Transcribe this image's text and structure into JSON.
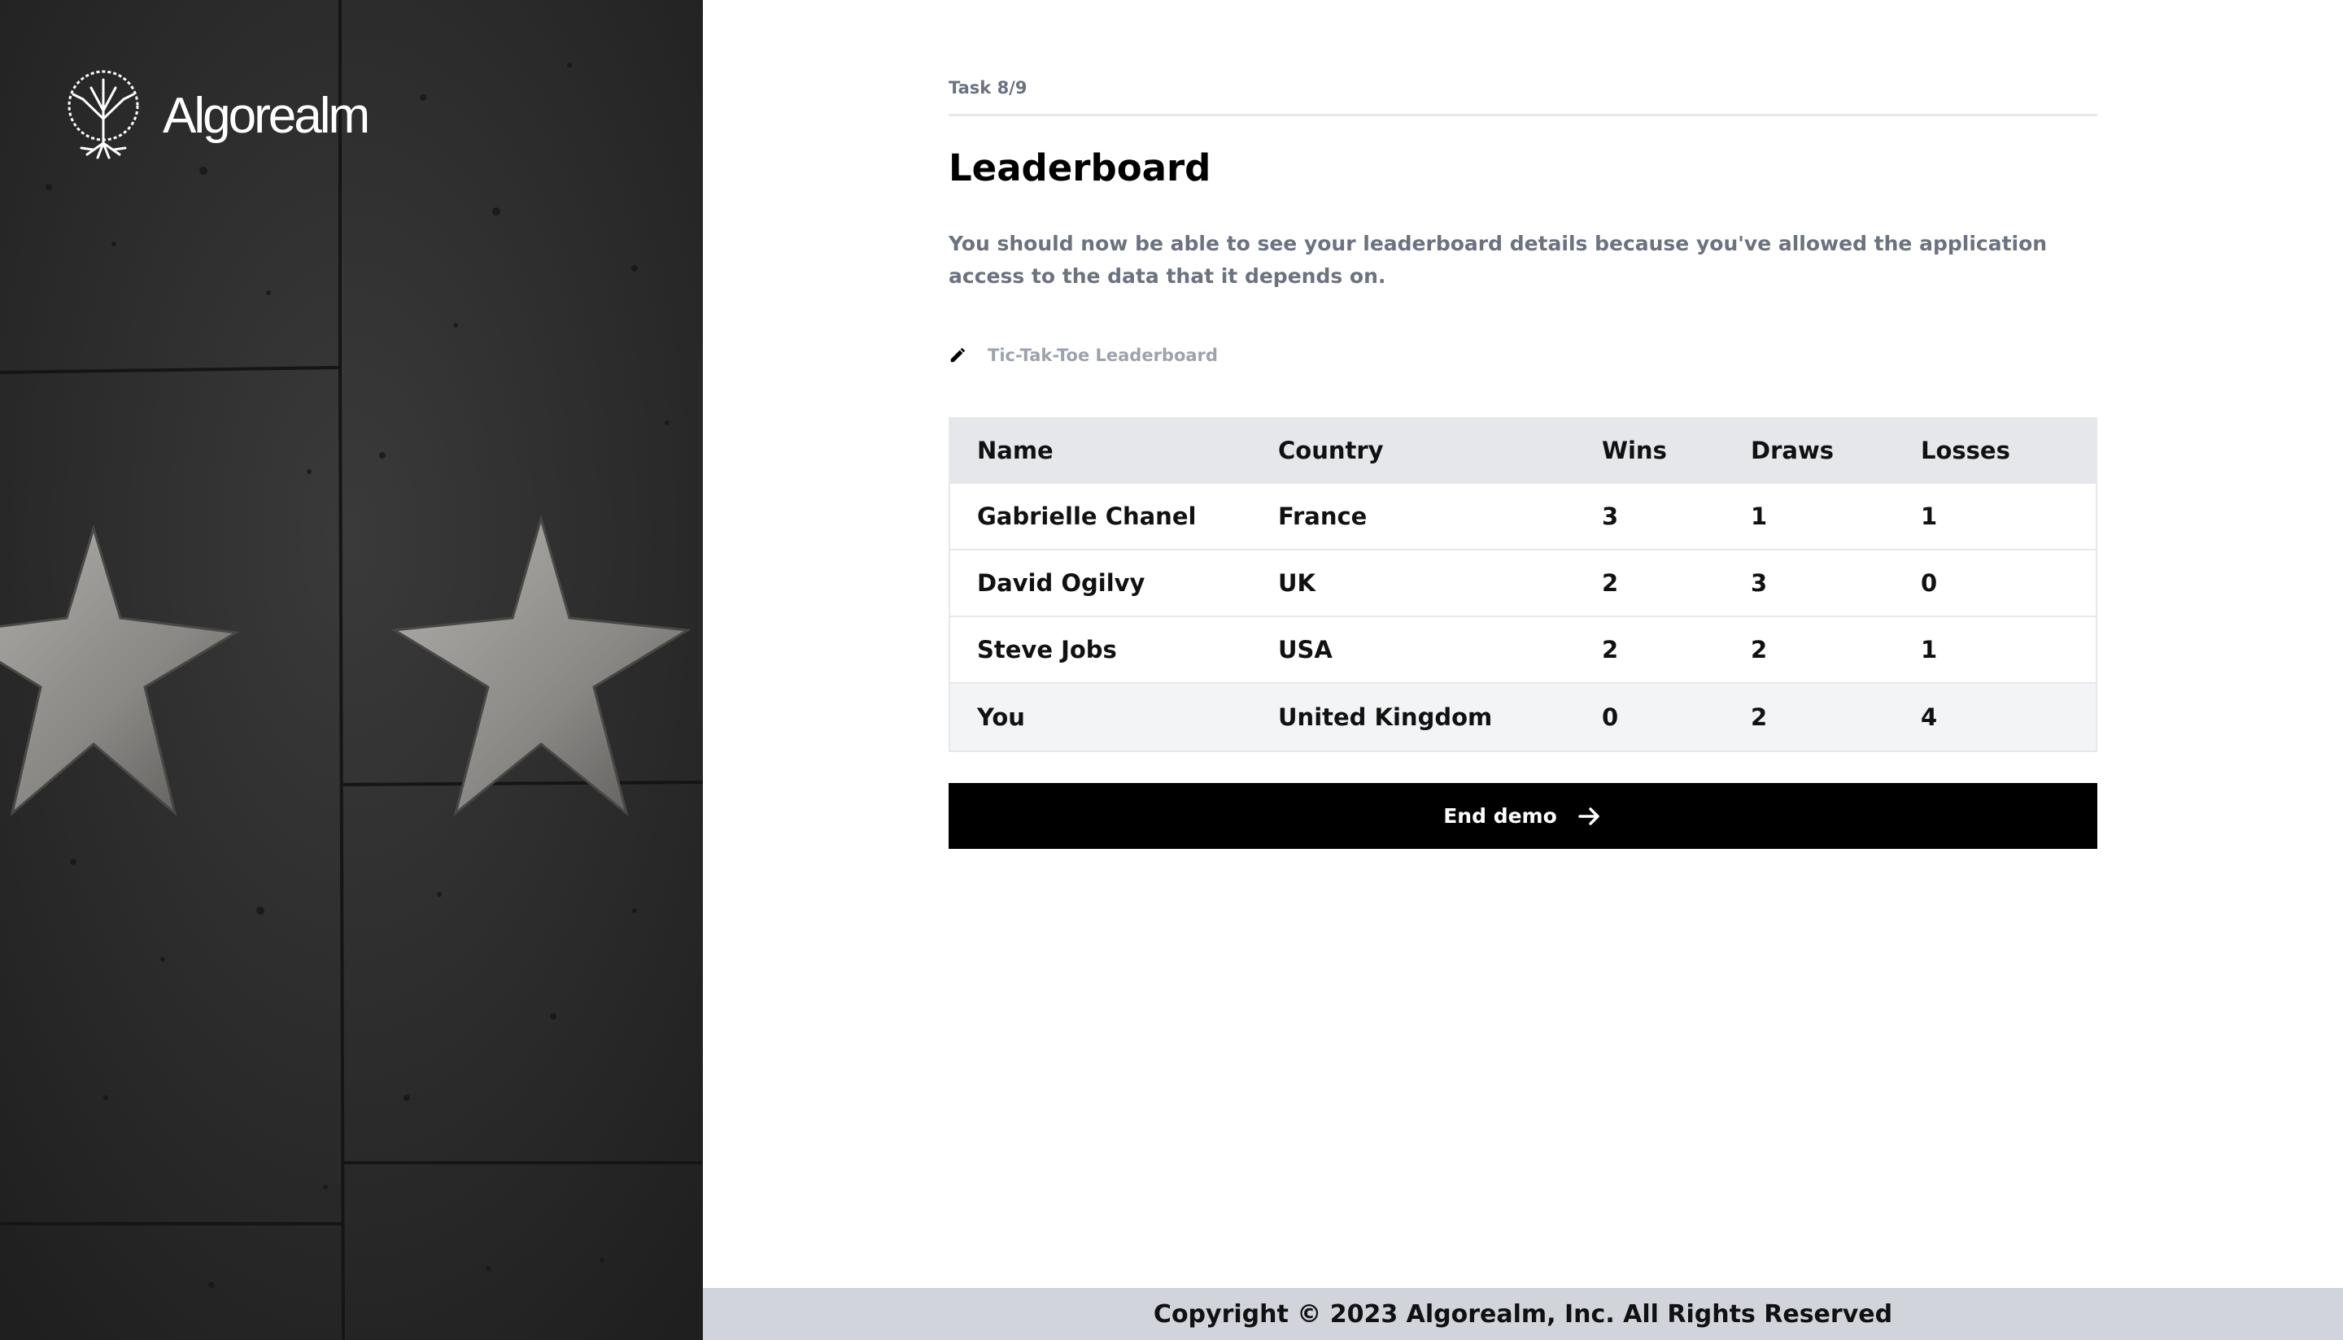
{
  "brand": {
    "name": "Algorealm",
    "logo_icon": "tree-icon"
  },
  "task": {
    "progress": "Task 8/9"
  },
  "page": {
    "title": "Leaderboard",
    "description": "You should now be able to see your leaderboard details because you've allowed the application access to the data that it depends on."
  },
  "data_source": {
    "icon": "pencil-icon",
    "label": "Tic-Tak-Toe Leaderboard"
  },
  "leaderboard": {
    "columns": [
      "Name",
      "Country",
      "Wins",
      "Draws",
      "Losses"
    ],
    "rows": [
      {
        "name": "Gabrielle Chanel",
        "country": "France",
        "wins": "3",
        "draws": "1",
        "losses": "1"
      },
      {
        "name": "David Ogilvy",
        "country": "UK",
        "wins": "2",
        "draws": "3",
        "losses": "0"
      },
      {
        "name": "Steve Jobs",
        "country": "USA",
        "wins": "2",
        "draws": "2",
        "losses": "1"
      },
      {
        "name": "You",
        "country": "United Kingdom",
        "wins": "0",
        "draws": "2",
        "losses": "4"
      }
    ]
  },
  "actions": {
    "end_demo_label": "End demo",
    "end_demo_icon": "arrow-right-icon"
  },
  "footer": {
    "copyright": "Copyright © 2023 Algorealm, Inc. All Rights Reserved"
  },
  "colors": {
    "accent": "#000000",
    "muted_text": "#6b7280",
    "table_header": "#e5e7eb",
    "footer_bg": "#d1d5db",
    "hero_bg": "#2e2e2e"
  }
}
